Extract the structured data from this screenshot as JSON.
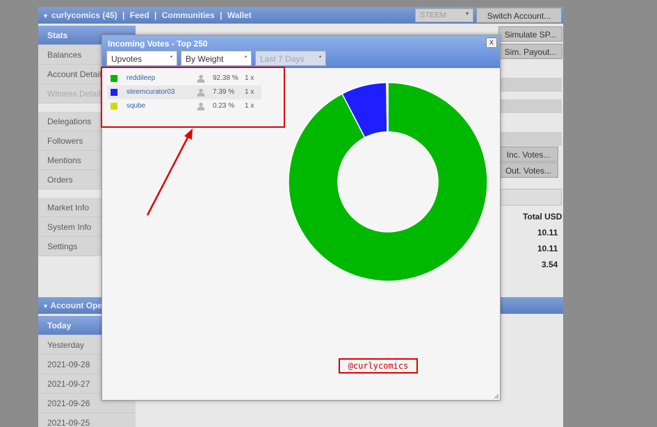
{
  "topbar": {
    "nav": [
      "curlycomics (45)",
      "|",
      "Feed",
      "|",
      "Communities",
      "|",
      "Wallet"
    ],
    "currency": "STEEM",
    "switch_label": "Switch Account..."
  },
  "sidebar": {
    "group1": [
      {
        "label": "Stats",
        "active": true
      },
      {
        "label": "Balances"
      },
      {
        "label": "Account Details"
      },
      {
        "label": "Witness Details",
        "disabled": true
      }
    ],
    "group2": [
      {
        "label": "Delegations"
      },
      {
        "label": "Followers"
      },
      {
        "label": "Mentions"
      },
      {
        "label": "Orders"
      }
    ],
    "group3": [
      {
        "label": "Market Info"
      },
      {
        "label": "System Info"
      },
      {
        "label": "Settings"
      }
    ]
  },
  "right": {
    "simulate_sp": "Simulate SP...",
    "sim_payout": "Sim. Payout...",
    "inc_votes": "Inc. Votes...",
    "out_votes": "Out. Votes...",
    "total_usd_header": "Total USD",
    "total_values": [
      "10.11",
      "10.11",
      "3.54"
    ]
  },
  "account_ops": {
    "header": "Account Oper",
    "dates": [
      {
        "label": "Today",
        "active": true
      },
      {
        "label": "Yesterday"
      },
      {
        "label": "2021-09-28"
      },
      {
        "label": "2021-09-27"
      },
      {
        "label": "2021-09-26"
      },
      {
        "label": "2021-09-25"
      }
    ]
  },
  "modal": {
    "title": "Incoming Votes - Top 250",
    "close": "x",
    "filter_type": "Upvotes",
    "sort": "By Weight",
    "period": "Last 7 Days",
    "stamp": "@curlycomics"
  },
  "chart_data": {
    "type": "pie",
    "donut": true,
    "categories": [
      "reddileep",
      "steemcurator03",
      "sqube"
    ],
    "percent_labels": [
      "92.38 %",
      "7.39 %",
      "0.23 %"
    ],
    "values": [
      92.38,
      7.39,
      0.23
    ],
    "counts": [
      "1 x",
      "1 x",
      "1 x"
    ],
    "colors": [
      "#00b800",
      "#1e1eff",
      "#d8d800"
    ]
  },
  "colors": {
    "accent": "#5f82c5",
    "annotation": "#e00000"
  }
}
